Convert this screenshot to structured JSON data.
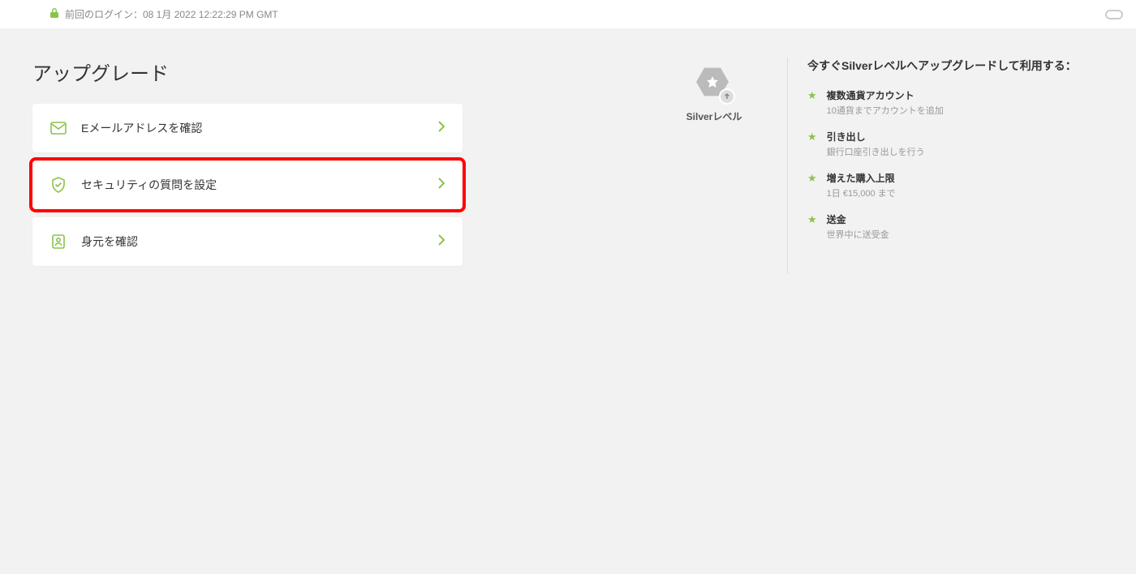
{
  "topBar": {
    "lastLogin": "前回のログイン：08 1月 2022 12:22:29 PM GMT"
  },
  "page": {
    "title": "アップグレード"
  },
  "actions": {
    "verifyEmail": "Eメールアドレスを確認",
    "setSecurityQ": "セキュリティの質問を設定",
    "verifyIdentity": "身元を確認"
  },
  "level": {
    "label": "Silverレベル"
  },
  "benefits": {
    "heading": "今すぐSilverレベルへアップグレードして利用する：",
    "items": [
      {
        "title": "複数通貨アカウント",
        "desc": "10通貨までアカウントを追加"
      },
      {
        "title": "引き出し",
        "desc": "銀行口座引き出しを行う"
      },
      {
        "title": "増えた購入上限",
        "desc": "1日 €15,000 まで"
      },
      {
        "title": "送金",
        "desc": "世界中に送受金"
      }
    ]
  }
}
